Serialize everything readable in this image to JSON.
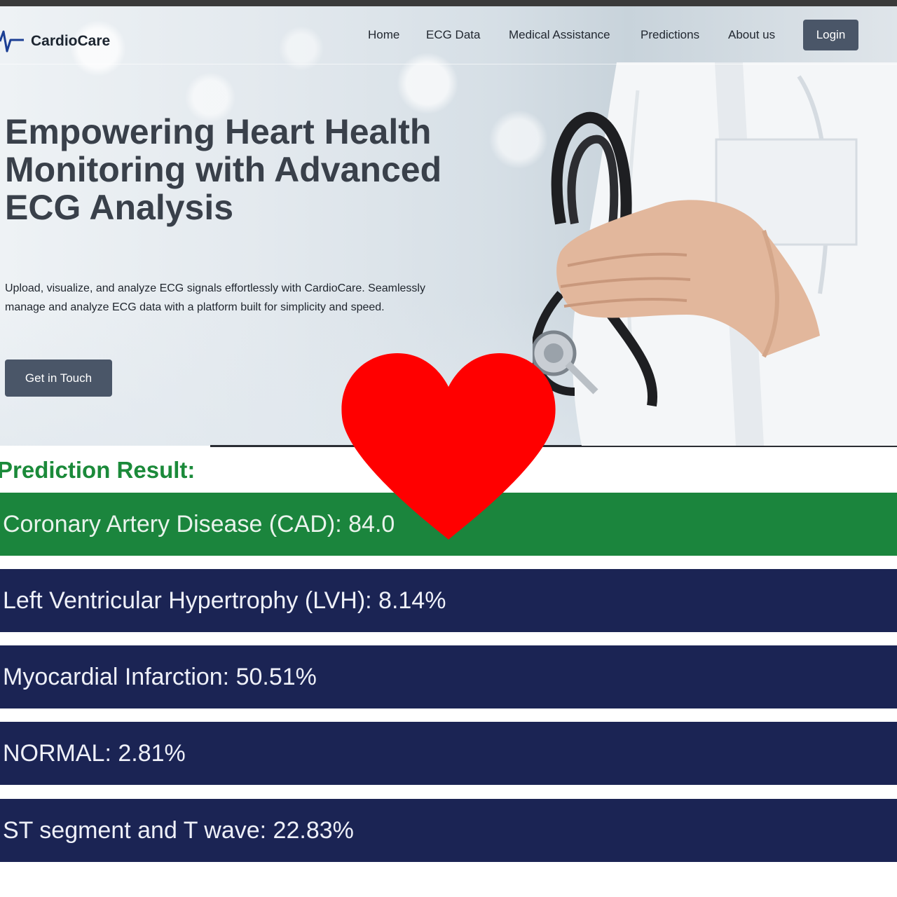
{
  "app": {
    "brand": "CardioCare"
  },
  "nav": {
    "links": [
      "Home",
      "ECG Data",
      "Medical Assistance",
      "Predictions",
      "About us"
    ],
    "login_label": "Login"
  },
  "hero": {
    "headline": "Empowering Heart Health Monitoring with Advanced ECG Analysis",
    "subtext": "Upload, visualize, and analyze ECG signals effortlessly with CardioCare. Seamlessly manage and analyze ECG data with a platform built for simplicity and speed.",
    "cta_label": "Get in Touch"
  },
  "results": {
    "title": "Prediction Result:",
    "items": [
      {
        "label": "Coronary Artery Disease (CAD): 84.0",
        "value_percent": 84.0
      },
      {
        "label": "Left Ventricular Hypertrophy (LVH): 8.14%",
        "value_percent": 8.14
      },
      {
        "label": "Myocardial Infarction: 50.51%",
        "value_percent": 50.51
      },
      {
        "label": "NORMAL: 2.81%",
        "value_percent": 2.81
      },
      {
        "label": "ST segment and T wave: 22.83%",
        "value_percent": 22.83
      }
    ]
  },
  "colors": {
    "brand_accent": "#1c3f94",
    "button_bg": "#4a5668",
    "result_highlight": "#1b853d",
    "result_default": "#1b2454",
    "title_green": "#1b8a3a",
    "heart": "#ff0000"
  },
  "icons": {
    "logo": "ecg-pulse-icon",
    "overlay": "heart-icon",
    "hero_image": "doctor-stethoscope-photo"
  }
}
